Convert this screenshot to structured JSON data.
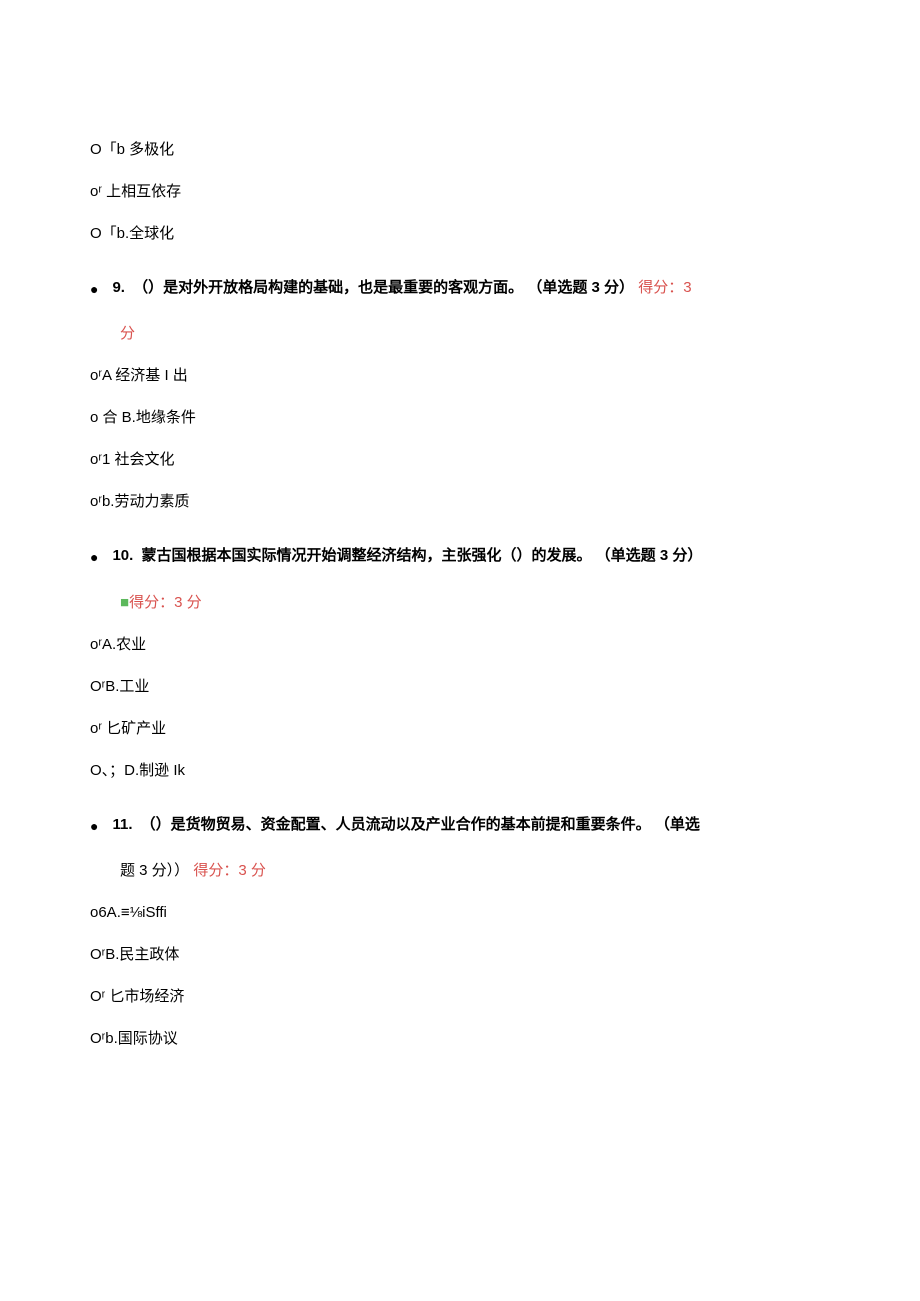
{
  "pre_options": [
    "O「b 多极化",
    "oʳ 上相互依存",
    "O「b.全球化"
  ],
  "questions": [
    {
      "num": "9.",
      "text": "（）是对外开放格局构建的基础，也是最重要的客观方面。 （单选题 3 分）",
      "score_prefix": "得分：3",
      "score_line2": "分",
      "score_style": "red",
      "options": [
        "oʳA 经济基 I 出",
        "o 合 B.地缘条件",
        "oʳ1 社会文化",
        "oʳb.劳动力素质"
      ]
    },
    {
      "num": "10.",
      "text": "蒙古国根据本国实际情况开始调整经济结构，主张强化（）的发展。 （单选题 3 分）",
      "score_prefix": "",
      "score_line2_mark": "■",
      "score_line2": "得分：3 分",
      "score_style": "green",
      "options": [
        "oʳA.农业",
        "OʳB.工业",
        "oʳ 匕矿产业",
        "O、；D.制逊 Ik"
      ]
    },
    {
      "num": "11.",
      "text": "（）是货物贸易、资金配置、人员流动以及产业合作的基本前提和重要条件。 （单选",
      "score_prefix": "",
      "score_line2_pre": "题 3 分））",
      "score_line2": "得分：3 分",
      "score_style": "red",
      "options": [
        "o6A.≡⅛iSffi",
        "OʳB.民主政体",
        "Oʳ 匕市场经济",
        "Oʳb.国际协议"
      ]
    }
  ]
}
